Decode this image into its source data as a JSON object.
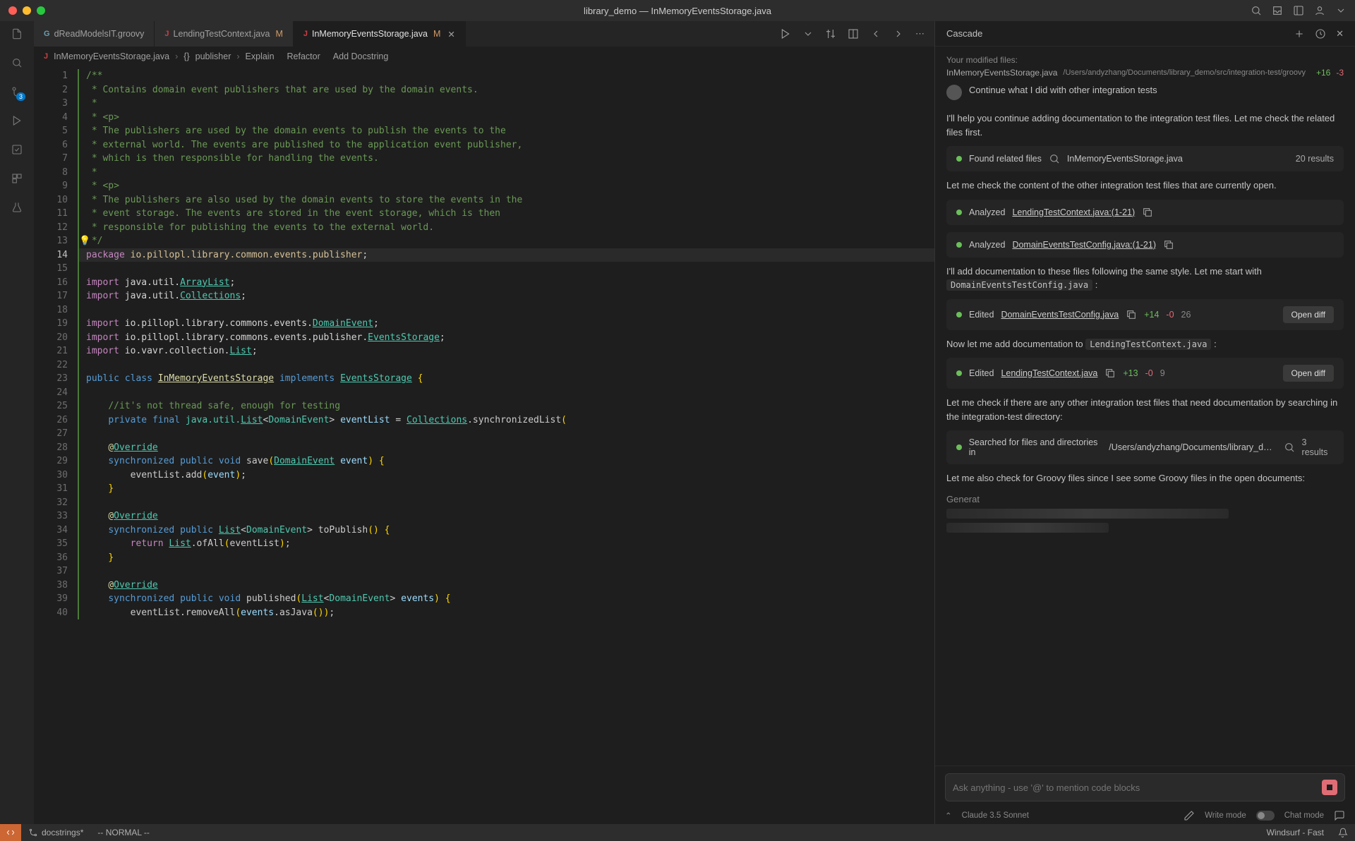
{
  "window": {
    "title": "library_demo — InMemoryEventsStorage.java"
  },
  "tabs": [
    {
      "name": "dReadModelsIT.groovy",
      "icon": "groovy",
      "modified": false,
      "active": false
    },
    {
      "name": "LendingTestContext.java",
      "icon": "java",
      "modified": true,
      "mod_label": "M",
      "active": false
    },
    {
      "name": "InMemoryEventsStorage.java",
      "icon": "java",
      "modified": true,
      "mod_label": "M",
      "active": true
    }
  ],
  "breadcrumbs": {
    "file": "InMemoryEventsStorage.java",
    "symbol_ns": "{}",
    "symbol": "publisher",
    "actions": [
      "Explain",
      "Refactor",
      "Add Docstring"
    ]
  },
  "activity_bar": {
    "badge_count": "3"
  },
  "code": {
    "lines": [
      {
        "n": 1,
        "html": "<span class='c-comment'>/**</span>"
      },
      {
        "n": 2,
        "html": "<span class='c-comment'> * Contains domain event publishers that are used by the domain events.</span>"
      },
      {
        "n": 3,
        "html": "<span class='c-comment'> *</span>"
      },
      {
        "n": 4,
        "html": "<span class='c-comment'> * &lt;p&gt;</span>"
      },
      {
        "n": 5,
        "html": "<span class='c-comment'> * The publishers are used by the domain events to publish the events to the</span>"
      },
      {
        "n": 6,
        "html": "<span class='c-comment'> * external world. The events are published to the application event publisher,</span>"
      },
      {
        "n": 7,
        "html": "<span class='c-comment'> * which is then responsible for handling the events.</span>"
      },
      {
        "n": 8,
        "html": "<span class='c-comment'> *</span>"
      },
      {
        "n": 9,
        "html": "<span class='c-comment'> * &lt;p&gt;</span>"
      },
      {
        "n": 10,
        "html": "<span class='c-comment'> * The publishers are also used by the domain events to store the events in the</span>"
      },
      {
        "n": 11,
        "html": "<span class='c-comment'> * event storage. The events are stored in the event storage, which is then</span>"
      },
      {
        "n": 12,
        "html": "<span class='c-comment'> * responsible for publishing the events to the external world.</span>"
      },
      {
        "n": 13,
        "html": "<span class='c-comment'> */</span>",
        "bulb": true
      },
      {
        "n": 14,
        "html": "<span class='c-keyword'>package</span> <span class='c-pkg'>io.pillopl.library.common.events.publisher</span>;",
        "current": true,
        "highlight": true
      },
      {
        "n": 15,
        "html": ""
      },
      {
        "n": 16,
        "html": "<span class='c-keyword'>import</span> <span class='c-op'>java.util.</span><span class='c-type'>ArrayList</span>;"
      },
      {
        "n": 17,
        "html": "<span class='c-keyword'>import</span> <span class='c-op'>java.util.</span><span class='c-type'>Collections</span>;"
      },
      {
        "n": 18,
        "html": ""
      },
      {
        "n": 19,
        "html": "<span class='c-keyword'>import</span> <span class='c-op'>io.pillopl.library.commons.events.</span><span class='c-type'>DomainEvent</span>;"
      },
      {
        "n": 20,
        "html": "<span class='c-keyword'>import</span> <span class='c-op'>io.pillopl.library.commons.events.publisher.</span><span class='c-type'>EventsStorage</span>;"
      },
      {
        "n": 21,
        "html": "<span class='c-keyword'>import</span> <span class='c-op'>io.vavr.collection.</span><span class='c-type'>List</span>;"
      },
      {
        "n": 22,
        "html": ""
      },
      {
        "n": 23,
        "html": "<span class='c-mod'>public</span> <span class='c-mod'>class</span> <span class='c-class'>InMemoryEventsStorage</span> <span class='c-mod'>implements</span> <span class='c-type'>EventsStorage</span> <span class='c-par'>{</span>"
      },
      {
        "n": 24,
        "html": ""
      },
      {
        "n": 25,
        "html": "    <span class='c-comment'>//it's not thread safe, enough for testing</span>"
      },
      {
        "n": 26,
        "html": "    <span class='c-mod'>private</span> <span class='c-mod'>final</span> <span class='c-type-nou'>java.util.</span><span class='c-type'>List</span>&lt;<span class='c-type-nou'>DomainEvent</span>&gt; <span class='c-ident'>eventList</span> = <span class='c-type'>Collections</span>.synchronizedList<span class='c-par'>(</span>"
      },
      {
        "n": 27,
        "html": ""
      },
      {
        "n": 28,
        "html": "    <span class='c-ann'>@</span><span class='c-type'>Override</span>"
      },
      {
        "n": 29,
        "html": "    <span class='c-mod'>synchronized</span> <span class='c-mod'>public</span> <span class='c-mod'>void</span> save<span class='c-par'>(</span><span class='c-type'>DomainEvent</span> <span class='c-ident'>event</span><span class='c-par'>)</span> <span class='c-par'>{</span>"
      },
      {
        "n": 30,
        "html": "        eventList.add<span class='c-par'>(</span><span class='c-ident'>event</span><span class='c-par'>)</span>;"
      },
      {
        "n": 31,
        "html": "    <span class='c-par'>}</span>"
      },
      {
        "n": 32,
        "html": ""
      },
      {
        "n": 33,
        "html": "    <span class='c-ann'>@</span><span class='c-type'>Override</span>"
      },
      {
        "n": 34,
        "html": "    <span class='c-mod'>synchronized</span> <span class='c-mod'>public</span> <span class='c-type'>List</span>&lt;<span class='c-type-nou'>DomainEvent</span>&gt; toPublish<span class='c-par'>()</span> <span class='c-par'>{</span>"
      },
      {
        "n": 35,
        "html": "        <span class='c-keyword'>return</span> <span class='c-type'>List</span>.ofAll<span class='c-par'>(</span>eventList<span class='c-par'>)</span>;"
      },
      {
        "n": 36,
        "html": "    <span class='c-par'>}</span>"
      },
      {
        "n": 37,
        "html": ""
      },
      {
        "n": 38,
        "html": "    <span class='c-ann'>@</span><span class='c-type'>Override</span>"
      },
      {
        "n": 39,
        "html": "    <span class='c-mod'>synchronized</span> <span class='c-mod'>public</span> <span class='c-mod'>void</span> published<span class='c-par'>(</span><span class='c-type'>List</span>&lt;<span class='c-type-nou'>DomainEvent</span>&gt; <span class='c-ident'>events</span><span class='c-par'>)</span> <span class='c-par'>{</span>"
      },
      {
        "n": 40,
        "html": "        eventList.removeAll<span class='c-par'>(</span><span class='c-ident'>events</span>.asJava<span class='c-par'>())</span>;"
      }
    ]
  },
  "cascade": {
    "title": "Cascade",
    "modified_header": "Your modified files:",
    "modified_file": {
      "name": "InMemoryEventsStorage.java",
      "path": "/Users/andyzhang/Documents/library_demo/src/integration-test/groovy",
      "add": "+16",
      "del": "-3"
    },
    "user_prompt": "Continue what I did with other integration tests",
    "msg1": "I'll help you continue adding documentation to the integration test files. Let me check the related files first.",
    "tool1": {
      "label": "Found related files",
      "target": "InMemoryEventsStorage.java",
      "results": "20 results"
    },
    "msg2": "Let me check the content of the other integration test files that are currently open.",
    "tool2": {
      "label": "Analyzed",
      "target": "LendingTestContext.java:(1-21)"
    },
    "tool3": {
      "label": "Analyzed",
      "target": "DomainEventsTestConfig.java:(1-21)"
    },
    "msg3_pre": "I'll add documentation to these files following the same style. Let me start with ",
    "msg3_code": "DomainEventsTestConfig.java",
    "msg3_post": " :",
    "tool4": {
      "label": "Edited",
      "target": "DomainEventsTestConfig.java",
      "add": "+14",
      "del": "-0",
      "total": "26",
      "open_diff": "Open diff"
    },
    "msg4_pre": "Now let me add documentation to ",
    "msg4_code": "LendingTestContext.java",
    "msg4_post": " :",
    "tool5": {
      "label": "Edited",
      "target": "LendingTestContext.java",
      "add": "+13",
      "del": "-0",
      "total": "9",
      "open_diff": "Open diff"
    },
    "msg5": "Let me check if there are any other integration test files that need documentation by searching in the integration-test directory:",
    "tool6": {
      "label": "Searched for files and directories in",
      "target": "/Users/andyzhang/Documents/library_dem...",
      "results": "3 results"
    },
    "msg6": "Let me also check for Groovy files since I see some Groovy files in the open documents:",
    "generating": "Generat",
    "input_placeholder": "Ask anything - use '@' to mention code blocks",
    "model": "Claude 3.5 Sonnet",
    "write_mode": "Write mode",
    "chat_mode": "Chat mode"
  },
  "status_bar": {
    "branch": "docstrings*",
    "vim_mode": "-- NORMAL --",
    "right_text": "Windsurf - Fast"
  }
}
